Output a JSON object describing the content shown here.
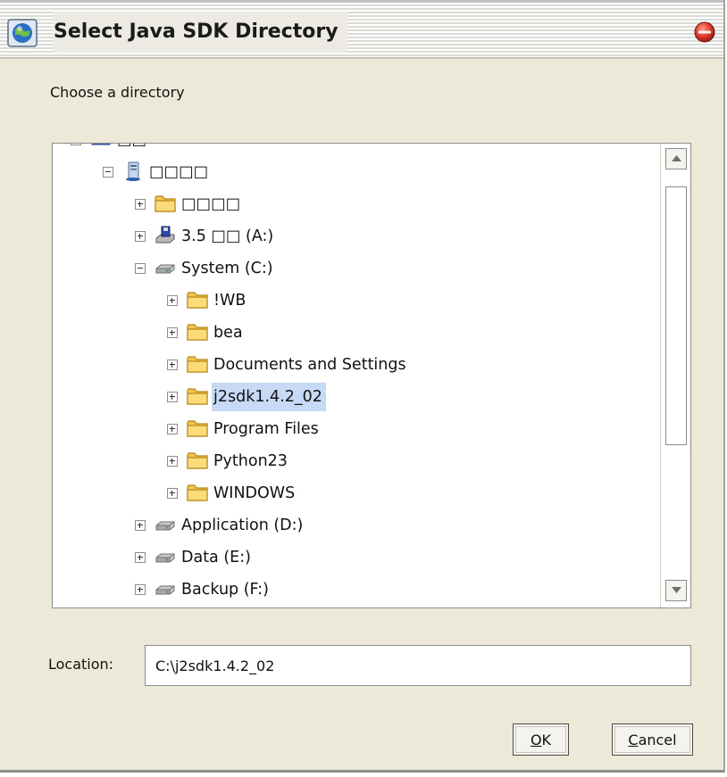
{
  "window": {
    "title": "Select Java SDK Directory",
    "icons": {
      "app": "globe-java-icon",
      "close": "close-icon"
    }
  },
  "prompt": "Choose a directory",
  "tree": {
    "items": [
      {
        "label": "□□",
        "icon": "desktop-icon",
        "state": "collapsed",
        "level": 0
      },
      {
        "label": "□□□□",
        "icon": "computer-icon",
        "state": "expanded",
        "level": 1
      },
      {
        "label": "□□□□",
        "icon": "folder-icon",
        "state": "collapsed",
        "level": 2
      },
      {
        "label": "3.5 □□ (A:)",
        "icon": "floppy-drive-icon",
        "state": "collapsed",
        "level": 2
      },
      {
        "label": "System (C:)",
        "icon": "hard-drive-icon",
        "state": "expanded",
        "level": 2
      },
      {
        "label": "!WB",
        "icon": "folder-icon",
        "state": "collapsed",
        "level": 3
      },
      {
        "label": "bea",
        "icon": "folder-icon",
        "state": "collapsed",
        "level": 3
      },
      {
        "label": "Documents and Settings",
        "icon": "folder-icon",
        "state": "collapsed",
        "level": 3
      },
      {
        "label": "j2sdk1.4.2_02",
        "icon": "folder-icon",
        "state": "collapsed",
        "level": 3,
        "selected": true
      },
      {
        "label": "Program Files",
        "icon": "folder-icon",
        "state": "collapsed",
        "level": 3
      },
      {
        "label": "Python23",
        "icon": "folder-icon",
        "state": "collapsed",
        "level": 3
      },
      {
        "label": "WINDOWS",
        "icon": "folder-icon",
        "state": "collapsed",
        "level": 3
      },
      {
        "label": "Application (D:)",
        "icon": "hard-drive-icon",
        "state": "collapsed",
        "level": 2
      },
      {
        "label": "Data (E:)",
        "icon": "hard-drive-icon",
        "state": "collapsed",
        "level": 2
      },
      {
        "label": "Backup (F:)",
        "icon": "hard-drive-icon",
        "state": "collapsed",
        "level": 2
      }
    ]
  },
  "location": {
    "label": "Location:",
    "value": "C:\\j2sdk1.4.2_02"
  },
  "buttons": {
    "ok": {
      "mnemonic": "O",
      "rest": "K"
    },
    "cancel": {
      "mnemonic": "C",
      "rest": "ancel"
    }
  },
  "colors": {
    "dialog_bg": "#ece9d8",
    "selection": "#c6daf5",
    "close_button": "#d9302a",
    "folder": "#f3c64a"
  }
}
